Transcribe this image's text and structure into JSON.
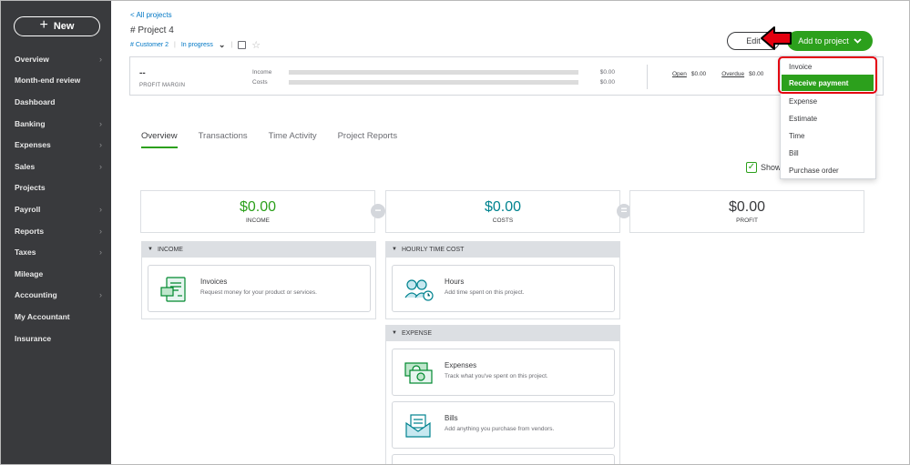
{
  "sidebar": {
    "new_label": "New",
    "items": [
      {
        "label": "Overview",
        "chevron": true
      },
      {
        "label": "Month-end review",
        "chevron": false
      },
      {
        "label": "Dashboard",
        "chevron": false
      },
      {
        "label": "Banking",
        "chevron": true
      },
      {
        "label": "Expenses",
        "chevron": true
      },
      {
        "label": "Sales",
        "chevron": true
      },
      {
        "label": "Projects",
        "chevron": false
      },
      {
        "label": "Payroll",
        "chevron": true
      },
      {
        "label": "Reports",
        "chevron": true
      },
      {
        "label": "Taxes",
        "chevron": true
      },
      {
        "label": "Mileage",
        "chevron": false
      },
      {
        "label": "Accounting",
        "chevron": true
      },
      {
        "label": "My Accountant",
        "chevron": false
      },
      {
        "label": "Insurance",
        "chevron": false
      }
    ]
  },
  "header": {
    "back_link": "< All projects",
    "title": "# Project 4",
    "customer": "# Customer 2",
    "status": "In progress",
    "edit_label": "Edit",
    "add_label": "Add to project"
  },
  "summary": {
    "margin_value": "--",
    "margin_label": "PROFIT MARGIN",
    "income_label": "Income",
    "income_amount": "$0.00",
    "costs_label": "Costs",
    "costs_amount": "$0.00",
    "open_label": "Open",
    "open_amount": "$0.00",
    "overdue_label": "Overdue",
    "overdue_amount": "$0.00"
  },
  "tabs": [
    "Overview",
    "Transactions",
    "Time Activity",
    "Project Reports"
  ],
  "show_label": "Show",
  "totals": {
    "income_amount": "$0.00",
    "income_label": "INCOME",
    "costs_amount": "$0.00",
    "costs_label": "COSTS",
    "profit_amount": "$0.00",
    "profit_label": "PROFIT",
    "minus": "−",
    "equals": "="
  },
  "sections": {
    "income": {
      "header": "INCOME",
      "tile_title": "Invoices",
      "tile_desc": "Request money for your product or services."
    },
    "hourly": {
      "header": "HOURLY TIME COST",
      "tile_title": "Hours",
      "tile_desc": "Add time spent on this project."
    },
    "expense": {
      "header": "EXPENSE",
      "tile1_title": "Expenses",
      "tile1_desc": "Track what you've spent on this project.",
      "tile2_title": "Bills",
      "tile2_desc": "Add anything you purchase from vendors."
    }
  },
  "dropdown": {
    "items": [
      "Invoice",
      "Receive payment",
      "Expense",
      "Estimate",
      "Time",
      "Bill",
      "Purchase order"
    ]
  },
  "colors": {
    "brand_green": "#2ca01c",
    "sidebar_bg": "#393a3d",
    "link_blue": "#0077c5",
    "callout_red": "#e4000f",
    "costs_teal": "#00838f"
  }
}
